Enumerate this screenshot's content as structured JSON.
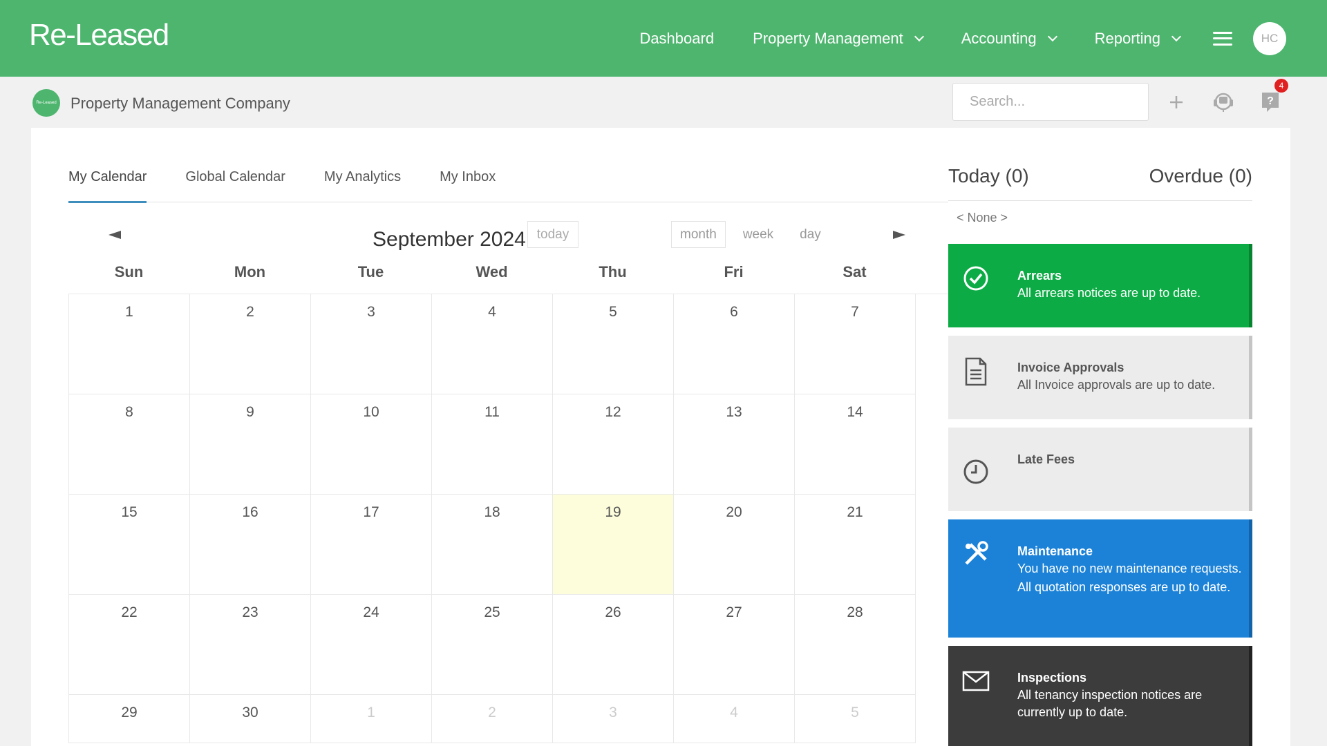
{
  "app": {
    "logo": "Re-Leased"
  },
  "nav": {
    "dashboard": "Dashboard",
    "property_management": "Property Management",
    "accounting": "Accounting",
    "reporting": "Reporting",
    "avatar_initials": "HC"
  },
  "subheader": {
    "company_logo_text": "Re-Leased",
    "company_name": "Property Management Company",
    "search_placeholder": "Search...",
    "help_badge_count": "4"
  },
  "tabs": [
    {
      "label": "My Calendar",
      "active": true
    },
    {
      "label": "Global Calendar"
    },
    {
      "label": "My Analytics"
    },
    {
      "label": "My Inbox"
    }
  ],
  "calendar": {
    "title": "September 2024",
    "today_label": "today",
    "views": [
      "month",
      "week",
      "day"
    ],
    "active_view": "month",
    "weekdays": [
      "Sun",
      "Mon",
      "Tue",
      "Wed",
      "Thu",
      "Fri",
      "Sat"
    ],
    "weeks": [
      [
        "1",
        "2",
        "3",
        "4",
        "5",
        "6",
        "7"
      ],
      [
        "8",
        "9",
        "10",
        "11",
        "12",
        "13",
        "14"
      ],
      [
        "15",
        "16",
        "17",
        "18",
        "19",
        "20",
        "21"
      ],
      [
        "22",
        "23",
        "24",
        "25",
        "26",
        "27",
        "28"
      ],
      [
        "29",
        "30",
        "1",
        "2",
        "3",
        "4",
        "5"
      ]
    ],
    "today_day": "19"
  },
  "sidebar": {
    "today_label": "Today (0)",
    "overdue_label": "Overdue (0)",
    "none_nav": "< None >",
    "cards": [
      {
        "title": "Arrears",
        "desc": "All arrears notices are up to date.",
        "icon": "check-circle-icon",
        "color": "#0cab45"
      },
      {
        "title": "Invoice Approvals",
        "desc": "All Invoice approvals are up to date.",
        "icon": "document-icon",
        "color": "#ececec"
      },
      {
        "title": "Late Fees",
        "desc": "",
        "icon": "clock-icon",
        "color": "#ececec"
      },
      {
        "title": "Maintenance",
        "desc": "You have no new maintenance requests.",
        "desc2": "All quotation responses are up to date.",
        "icon": "tools-icon",
        "color": "#1b82d8"
      },
      {
        "title": "Inspections",
        "desc": "All tenancy inspection notices are currently up to date.",
        "icon": "envelope-icon",
        "color": "#3c3c3c"
      }
    ]
  }
}
